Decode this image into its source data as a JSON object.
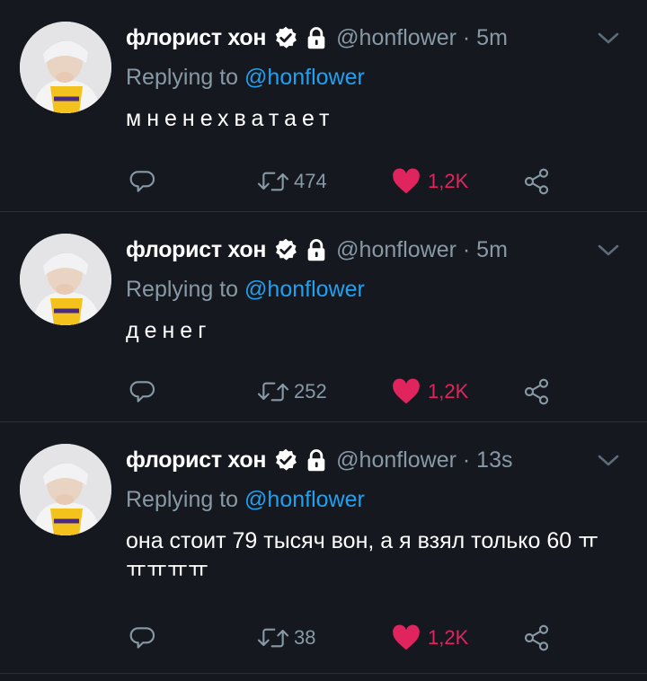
{
  "tweets": [
    {
      "author_name": "флорист хон",
      "handle": "@honflower · 5m",
      "replying_prefix": "Replying to ",
      "replying_to": "@honflower",
      "text": "мненехватает",
      "retweets": "474",
      "likes": "1,2K"
    },
    {
      "author_name": "флорист хон",
      "handle": "@honflower · 5m",
      "replying_prefix": "Replying to ",
      "replying_to": "@honflower",
      "text": "денег",
      "retweets": "252",
      "likes": "1,2K"
    },
    {
      "author_name": "флорист хон",
      "handle": "@honflower · 13s",
      "replying_prefix": "Replying to ",
      "replying_to": "@honflower",
      "text": "она стоит 79 тысяч вон, а я взял только 60 ㅠㅠㅠㅠㅠ",
      "retweets": "38",
      "likes": "1,2K"
    }
  ],
  "icons": {
    "verified": "verified-badge-icon",
    "lock": "lock-icon",
    "more": "chevron-down-icon",
    "reply": "reply-icon",
    "retweet": "retweet-icon",
    "like": "heart-icon",
    "share": "share-icon"
  },
  "colors": {
    "background": "#15181f",
    "secondary_text": "#8899a6",
    "link": "#1da1f2",
    "like": "#e0245e"
  }
}
